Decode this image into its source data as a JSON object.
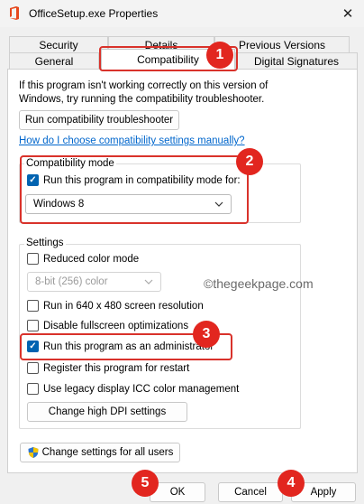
{
  "window": {
    "title": "OfficeSetup.exe Properties"
  },
  "tabs": {
    "row1": [
      "Security",
      "Details",
      "Previous Versions"
    ],
    "row2": [
      "General",
      "Compatibility",
      "Digital Signatures"
    ]
  },
  "intro_text": "If this program isn't working correctly on this version of Windows, try running the compatibility troubleshooter.",
  "run_troubleshooter_label": "Run compatibility troubleshooter",
  "help_link": "How do I choose compatibility settings manually?",
  "compat_mode": {
    "group_label": "Compatibility mode",
    "checkbox_label": "Run this program in compatibility mode for:",
    "checked": true,
    "selected_os": "Windows 8"
  },
  "settings": {
    "group_label": "Settings",
    "reduced_color": {
      "label": "Reduced color mode",
      "checked": false
    },
    "color_select_value": "8-bit (256) color",
    "run_640": {
      "label": "Run in 640 x 480 screen resolution",
      "checked": false
    },
    "disable_fullscreen": {
      "label": "Disable fullscreen optimizations",
      "checked": false
    },
    "run_admin": {
      "label": "Run this program as an administrator",
      "checked": true
    },
    "register_restart": {
      "label": "Register this program for restart",
      "checked": false
    },
    "legacy_icc": {
      "label": "Use legacy display ICC color management",
      "checked": false
    },
    "high_dpi_label": "Change high DPI settings"
  },
  "all_users_label": "Change settings for all users",
  "watermark": "©thegeekpage.com",
  "footer": {
    "ok": "OK",
    "cancel": "Cancel",
    "apply": "Apply"
  },
  "badges": [
    "1",
    "2",
    "3",
    "4",
    "5"
  ],
  "colors": {
    "highlight": "#d9322b",
    "badge": "#e2261f",
    "accent": "#0063b1",
    "link": "#0066cc"
  }
}
